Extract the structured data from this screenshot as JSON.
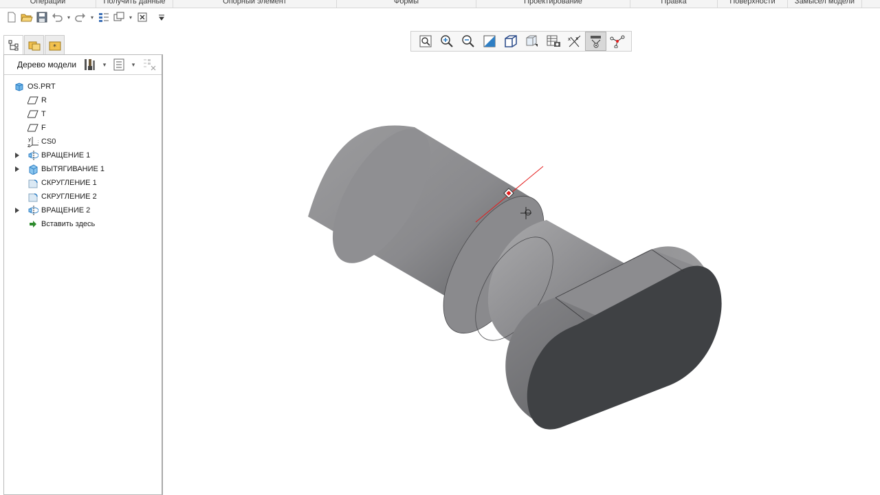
{
  "ribbon": {
    "groups": [
      "Операции",
      "Получить данные",
      "Опорный элемент",
      "Формы",
      "Проектирование",
      "Правка",
      "Поверхности",
      "Замысел модели"
    ]
  },
  "quick_access": {
    "icons": [
      "new-icon",
      "open-icon",
      "save-icon",
      "undo-icon",
      "redo-icon",
      "regenerate-icon",
      "windows-icon",
      "close-window-icon",
      "customize-icon"
    ]
  },
  "navigator": {
    "tabs": [
      "model-tree-tab",
      "folder-browser-tab",
      "favorites-tab"
    ],
    "title": "Дерево модели",
    "tree": [
      {
        "label": "OS.PRT",
        "icon": "part-icon",
        "level": 0,
        "expandable": false
      },
      {
        "label": "R",
        "icon": "datum-plane-icon",
        "level": 1,
        "expandable": false
      },
      {
        "label": "T",
        "icon": "datum-plane-icon",
        "level": 1,
        "expandable": false
      },
      {
        "label": "F",
        "icon": "datum-plane-icon",
        "level": 1,
        "expandable": false
      },
      {
        "label": "CS0",
        "icon": "coordinate-system-icon",
        "level": 1,
        "expandable": false
      },
      {
        "label": "ВРАЩЕНИЕ 1",
        "icon": "revolve-icon",
        "level": 1,
        "expandable": true
      },
      {
        "label": "ВЫТЯГИВАНИЕ 1",
        "icon": "extrude-icon",
        "level": 1,
        "expandable": true
      },
      {
        "label": "СКРУГЛЕНИЕ 1",
        "icon": "round-icon",
        "level": 1,
        "expandable": false
      },
      {
        "label": "СКРУГЛЕНИЕ 2",
        "icon": "round-icon",
        "level": 1,
        "expandable": false
      },
      {
        "label": "ВРАЩЕНИЕ 2",
        "icon": "revolve-icon",
        "level": 1,
        "expandable": true
      },
      {
        "label": "Вставить здесь",
        "icon": "insert-here-icon",
        "level": 1,
        "expandable": false
      }
    ]
  },
  "view_toolbar": {
    "icons": [
      "refit-icon",
      "zoom-in-icon",
      "zoom-out-icon",
      "repaint-icon",
      "display-style-icon",
      "saved-views-icon",
      "view-manager-icon",
      "datum-display-icon",
      "annotation-display-icon",
      "spin-center-icon"
    ],
    "active": "annotation-display-icon"
  },
  "colors": {
    "model_light": "#a7a7a9",
    "model_mid": "#7d7d80",
    "model_dark": "#3e4043",
    "axis_red": "#e41b1b",
    "tree_blue": "#2f7fc4",
    "insert_green": "#2e8b2e"
  }
}
